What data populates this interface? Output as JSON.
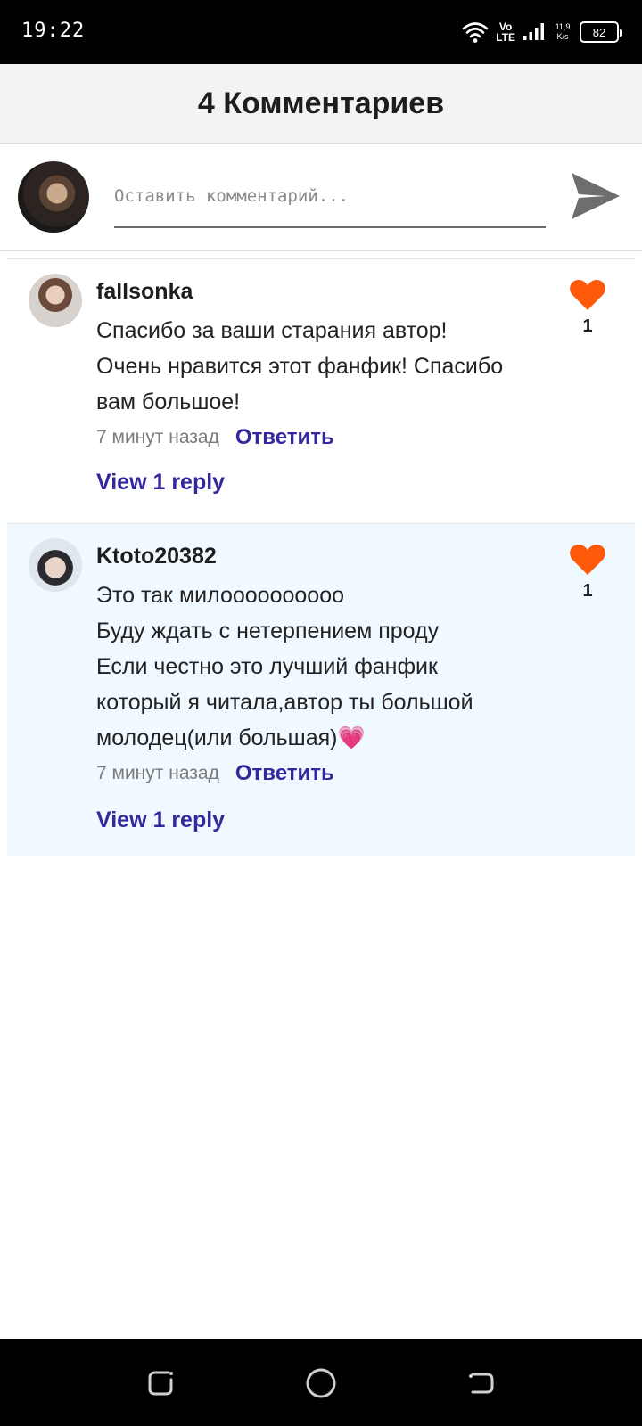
{
  "status_bar": {
    "time": "19:22",
    "volte_top": "Vo",
    "volte_bottom": "LTE",
    "speed_value": "11,9",
    "speed_unit": "K/s",
    "battery": "82"
  },
  "header": {
    "title": "4 Комментариев"
  },
  "composer": {
    "placeholder": "Оставить комментарий..."
  },
  "comments": [
    {
      "author": "fallsonka",
      "lines": [
        "Спасибо за ваши старания автор!",
        "Очень нравится этот фанфик! Спасибо",
        "вам большое!"
      ],
      "time": "7 минут назад",
      "reply_label": "Ответить",
      "view_replies": "View 1 reply",
      "likes": "1"
    },
    {
      "author": "Ktoto20382",
      "lines": [
        "Это так милоооооооооо",
        "Буду ждать с нетерпением проду",
        "Если честно это лучший фанфик",
        "который я читала,автор ты большой",
        "молодец(или большая)💗"
      ],
      "time": "7 минут назад",
      "reply_label": "Ответить",
      "view_replies": "View 1 reply",
      "likes": "1"
    }
  ],
  "colors": {
    "heart": "#ff5a0a",
    "link": "#33289c",
    "highlight_bg": "#f0f9ff"
  }
}
